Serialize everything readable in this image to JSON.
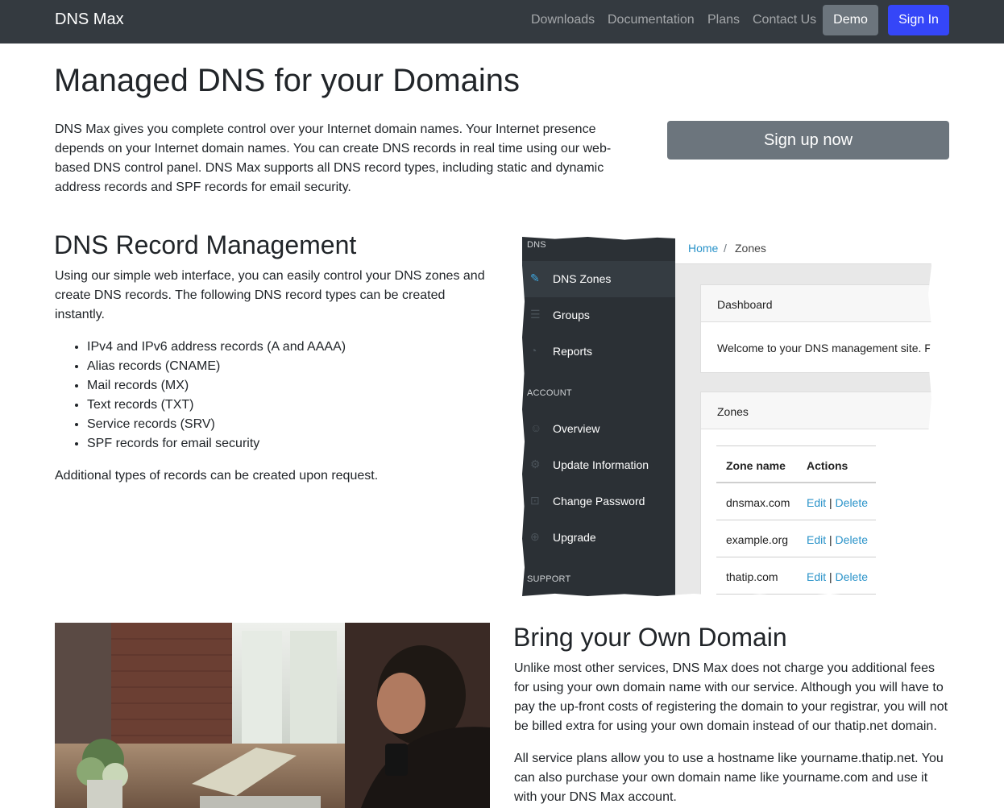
{
  "navbar": {
    "brand": "DNS Max",
    "links": [
      "Downloads",
      "Documentation",
      "Plans",
      "Contact Us"
    ],
    "demo": "Demo",
    "signin": "Sign In"
  },
  "hero": {
    "title": "Managed DNS for your Domains",
    "text": "DNS Max gives you complete control over your Internet domain names. Your Internet presence depends on your Internet domain names. You can create DNS records in real time using our web-based DNS control panel. DNS Max supports all DNS record types, including static and dynamic address records and SPF records for email security.",
    "signup": "Sign up now"
  },
  "records": {
    "title": "DNS Record Management",
    "text": "Using our simple web interface, you can easily control your DNS zones and create DNS records. The following DNS record types can be created instantly.",
    "items": [
      "IPv4 and IPv6 address records (A and AAAA)",
      "Alias records (CNAME)",
      "Mail records (MX)",
      "Text records (TXT)",
      "Service records (SRV)",
      "SPF records for email security"
    ],
    "extra": "Additional types of records can be created upon request."
  },
  "app": {
    "sections": {
      "dns": "DNS",
      "account": "ACCOUNT",
      "support": "SUPPORT"
    },
    "sidebar": [
      {
        "label": "DNS Zones",
        "icon": "pencil-icon"
      },
      {
        "label": "Groups",
        "icon": "list-icon"
      },
      {
        "label": "Reports",
        "icon": "pie-chart-icon"
      },
      {
        "label": "Overview",
        "icon": "user-icon"
      },
      {
        "label": "Update Information",
        "icon": "gear-icon"
      },
      {
        "label": "Change Password",
        "icon": "lock-icon"
      },
      {
        "label": "Upgrade",
        "icon": "upgrade-icon"
      }
    ],
    "breadcrumb": {
      "home": "Home",
      "sep": "/",
      "current": "Zones"
    },
    "dashboard": {
      "title": "Dashboard",
      "text": "Welcome to your DNS management site. F"
    },
    "zones": {
      "title": "Zones",
      "headers": {
        "name": "Zone name",
        "actions": "Actions"
      },
      "rows": [
        {
          "name": "dnsmax.com"
        },
        {
          "name": "example.org"
        },
        {
          "name": "thatip.com"
        }
      ],
      "edit": "Edit",
      "sep": "|",
      "delete": "Delete"
    }
  },
  "byod": {
    "title": "Bring your Own Domain",
    "p1": "Unlike most other services, DNS Max does not charge you additional fees for using your own domain name with our service. Although you will have to pay the up-front costs of registering the domain to your registrar, you will not be billed extra for using your own domain instead of our thatip.net domain.",
    "p2": "All service plans allow you to use a hostname like yourname.thatip.net. You can also purchase your own domain name like yourname.com and use it with your DNS Max account."
  }
}
